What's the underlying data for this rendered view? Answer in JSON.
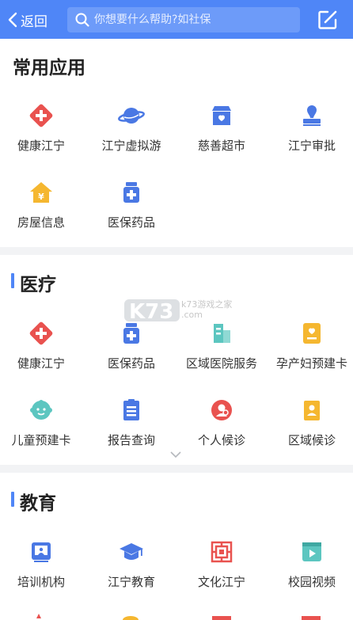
{
  "header": {
    "back_label": "返回",
    "search_placeholder": "你想要什么帮助?如社保"
  },
  "common": {
    "title": "常用应用",
    "apps": [
      "健康江宁",
      "江宁虚拟游",
      "慈善超市",
      "江宁审批",
      "房屋信息",
      "医保药品"
    ]
  },
  "medical": {
    "title": "医疗",
    "apps": [
      "健康江宁",
      "医保药品",
      "区域医院服务",
      "孕产妇预建卡",
      "儿童预建卡",
      "报告查询",
      "个人候诊",
      "区域候诊"
    ]
  },
  "education": {
    "title": "教育",
    "apps": [
      "培训机构",
      "江宁教育",
      "文化江宁",
      "校园视频"
    ]
  },
  "watermark": "k73游戏之家 .com",
  "colors": {
    "accent": "#4f86f7",
    "red": "#e9524f",
    "blue": "#4a78e4",
    "teal": "#5cc6c0",
    "orange": "#f5b730"
  }
}
